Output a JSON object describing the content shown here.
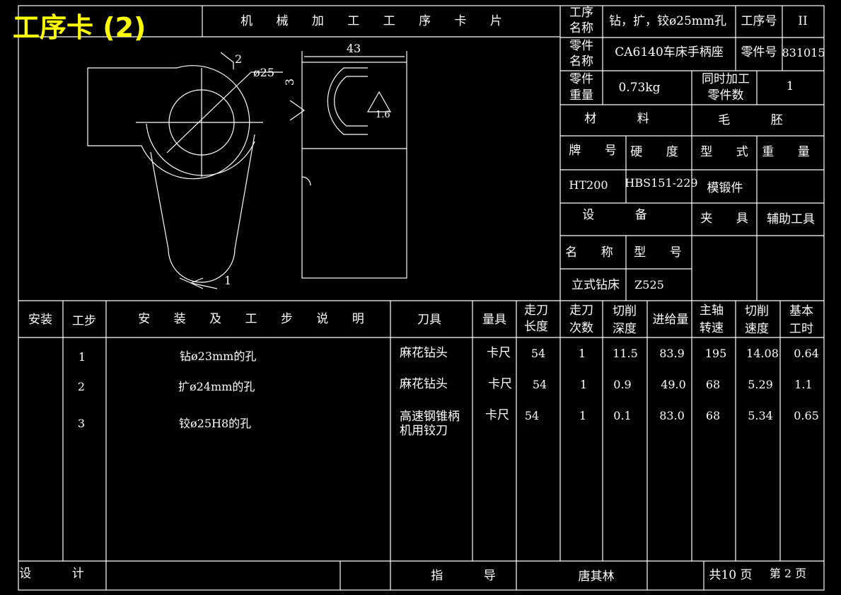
{
  "page_title": "工序卡 (2)",
  "header": {
    "card_title": "机 械 加 工 工 序 卡 片",
    "process_name_label": [
      "工序",
      "名称"
    ],
    "process_name": "钻，扩，铰ø25mm孔",
    "process_no_label": "工序号",
    "process_no": "II",
    "part_name_label": [
      "零件",
      "名称"
    ],
    "part_name": "CA6140车床手柄座",
    "part_no_label": "零件号",
    "part_no": "831015",
    "part_weight_label": [
      "零件",
      "重量"
    ],
    "part_weight": "0.73kg",
    "simul_label": [
      "同时加工",
      "零件数"
    ],
    "simul_count": "1"
  },
  "material": {
    "material_label": "材 料",
    "blank_label": "毛 胚",
    "grade_label": "牌 号",
    "hardness_label": "硬 度",
    "type_label": "型 式",
    "weight_label": "重 量",
    "grade": "HT200",
    "hardness": "HBS151-229",
    "blank_type": "模锻件"
  },
  "equipment": {
    "equipment_label": "设 备",
    "fixture_label": "夹 具",
    "fixture": "辅助工具",
    "name_label": "名 称",
    "model_label": "型 号",
    "name": "立式钻床",
    "model": "Z525"
  },
  "drawing": {
    "dim_width": "43",
    "dim_diameter": "ø25",
    "dim_3": "3",
    "roughness": "1.6",
    "mark_2": "2",
    "mark_1": "1"
  },
  "steps_table": {
    "headers": {
      "install": "安装",
      "step": "工步",
      "desc": "安 装 及 工 步 说 明",
      "tool": "刀具",
      "gauge": "量具",
      "feed_len": [
        "走刀",
        "长度"
      ],
      "passes": [
        "走刀",
        "次数"
      ],
      "cut_depth": [
        "切削",
        "深度"
      ],
      "feed": "进给量",
      "spindle": [
        "主轴",
        "转速"
      ],
      "cut_speed": [
        "切削",
        "速度"
      ],
      "basic_time": [
        "基本",
        "工时"
      ]
    },
    "rows": [
      {
        "step": "1",
        "desc": "钻ø23mm的孔",
        "tool": [
          "麻花钻头"
        ],
        "gauge": "卡尺",
        "feed_len": "54",
        "passes": "1",
        "depth": "11.5",
        "feed": "83.9",
        "spindle": "195",
        "speed": "14.08",
        "time": "0.64"
      },
      {
        "step": "2",
        "desc": "扩ø24mm的孔",
        "tool": [
          "麻花钻头"
        ],
        "gauge": "卡尺",
        "feed_len": "54",
        "passes": "1",
        "depth": "0.9",
        "feed": "49.0",
        "spindle": "68",
        "speed": "5.29",
        "time": "1.1"
      },
      {
        "step": "3",
        "desc": "铰ø25H8的孔",
        "tool": [
          "高速钢锥柄",
          "机用铰刀"
        ],
        "gauge": "卡尺",
        "feed_len": "54",
        "passes": "1",
        "depth": "0.1",
        "feed": "83.0",
        "spindle": "68",
        "speed": "5.34",
        "time": "0.65"
      }
    ]
  },
  "footer": {
    "design_label": "设 计",
    "guide_label": "指 导",
    "guide_name": "唐其林",
    "total_pages": "共10 页",
    "page_no": "第 2 页"
  },
  "colors": {
    "background": "#000000",
    "lines": "#ffffff",
    "title": "#ffff00"
  }
}
